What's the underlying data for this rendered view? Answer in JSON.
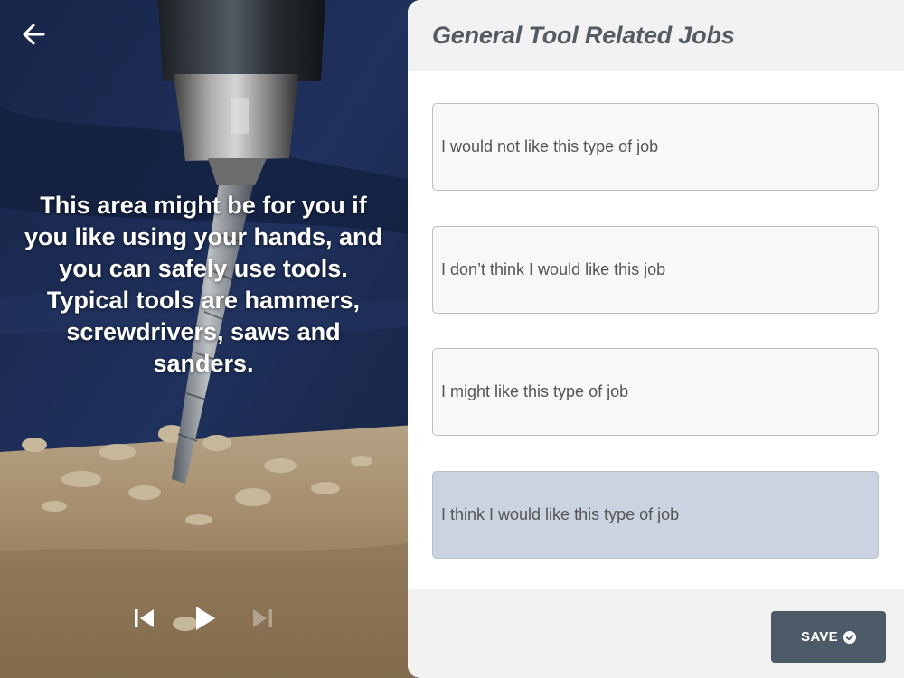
{
  "header": {
    "title": "General Tool Related Jobs"
  },
  "intro": {
    "text": "This area might be for you if you like using your hands, and you can safely use tools. Typical tools are hammers, screwdrivers, saws and sanders."
  },
  "options": [
    {
      "label": "I would not like this type of job",
      "selected": false
    },
    {
      "label": "I don’t think I would like this job",
      "selected": false
    },
    {
      "label": "I might like this type of job",
      "selected": false
    },
    {
      "label": "I think I would like this type of job",
      "selected": true
    }
  ],
  "footer": {
    "save_label": "SAVE"
  },
  "media_controls": {
    "previous_enabled": true,
    "play_enabled": true,
    "next_enabled": false
  },
  "colors": {
    "selected_option": "#c9d4e0",
    "save_button": "#4d5a68",
    "panel_header": "#f2f2f2"
  },
  "icons": {
    "back": "arrow-left-icon",
    "previous": "skip-previous-icon",
    "play": "play-icon",
    "next": "skip-next-icon",
    "save": "check-circle-icon"
  }
}
